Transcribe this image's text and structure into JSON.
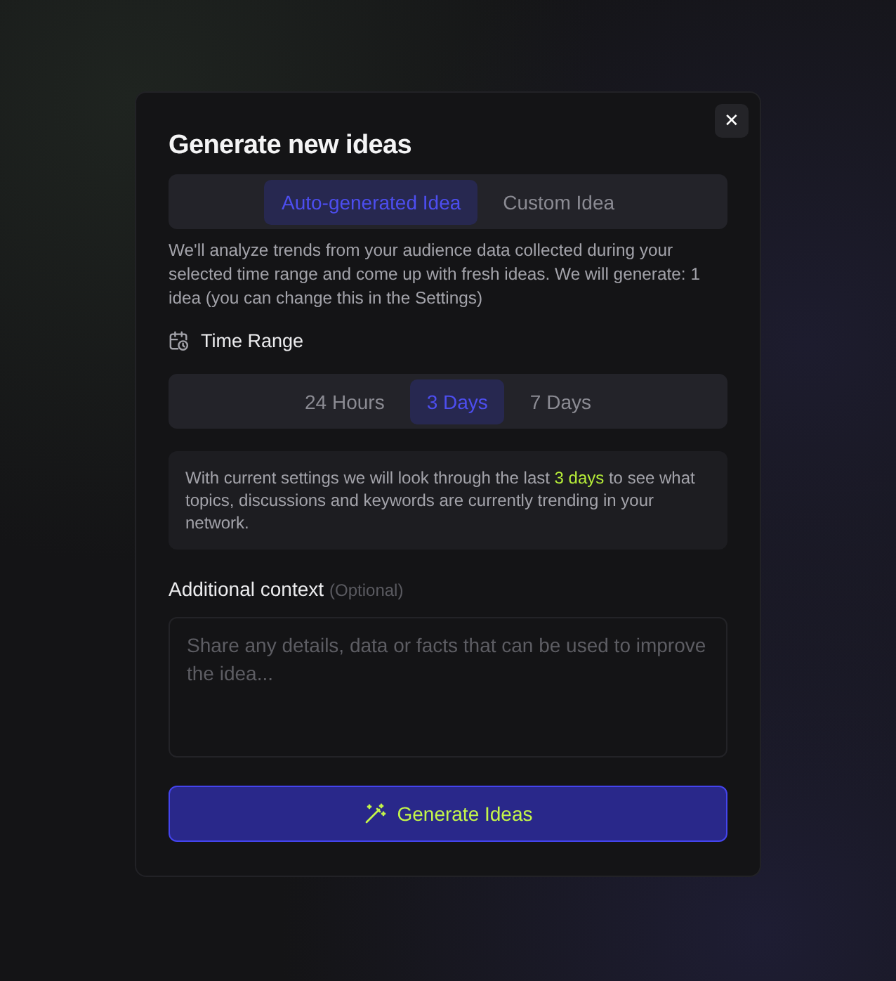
{
  "dialog": {
    "title": "Generate new ideas",
    "close_label": "✕"
  },
  "mode_tabs": [
    {
      "label": "Auto-generated Idea",
      "selected": true
    },
    {
      "label": "Custom Idea",
      "selected": false
    }
  ],
  "description": "We'll analyze trends from your audience data collected during your selected time range and come up with fresh ideas. We will generate: 1 idea (you can change this in the Settings)",
  "time_range": {
    "label": "Time Range",
    "options": [
      {
        "label": "24 Hours",
        "selected": false
      },
      {
        "label": "3 Days",
        "selected": true
      },
      {
        "label": "7 Days",
        "selected": false
      }
    ]
  },
  "info": {
    "text_before": "With current settings we will look through the last ",
    "highlight": "3 days",
    "text_after": " to see what topics, discussions and keywords are currently trending in your network."
  },
  "context": {
    "label": "Additional context",
    "hint": "(Optional)",
    "placeholder": "Share any details, data or facts that can be used to improve the idea..."
  },
  "submit": {
    "label": "Generate Ideas"
  }
}
